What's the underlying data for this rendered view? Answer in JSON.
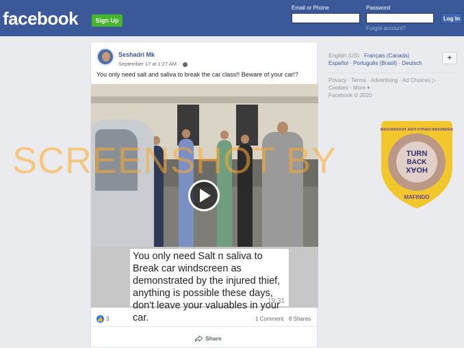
{
  "header": {
    "logo": "facebook",
    "signup_label": "Sign Up",
    "email_label": "Email or Phone",
    "password_label": "Password",
    "login_label": "Log In",
    "forgot_label": "Forgot account?"
  },
  "post": {
    "author": "Seshadri Mk",
    "timestamp": "September 17 at 1:27 AM · ",
    "text": "You only need salt and saliva to break the car class!! Beware of your car!?",
    "video_caption": "You only need Salt n saliva to Break car windscreen as demonstrated by the injured thief, anything is possible these days,  don't leave your valuables in your car.",
    "video_time": "19:31",
    "like_count": "3",
    "comments": "1 Comment",
    "shares": "8 Shares",
    "share_label": "Share"
  },
  "watermark": "SCREENSHOT BY",
  "sidebar": {
    "languages": [
      "English (US)",
      "Français (Canada)",
      "Español",
      "Português (Brasil)",
      "Deutsch"
    ],
    "plus_label": "+",
    "footer_links": [
      "Privacy",
      "Terms",
      "Advertising",
      "Ad Choices",
      "Cookies",
      "More"
    ],
    "copyright": "Facebook © 2020"
  },
  "seal": {
    "outer_text": "MASYARAKAT ANTI FITNAH INDONESIA",
    "inner_lines": [
      "TURN",
      "BACK",
      "HOAX"
    ],
    "bottom_text": "MAFINDO"
  },
  "colors": {
    "brand": "#3b5998",
    "signup": "#42b72a",
    "seal_yellow": "#f2c31b",
    "watermark": "#ffaa28"
  }
}
